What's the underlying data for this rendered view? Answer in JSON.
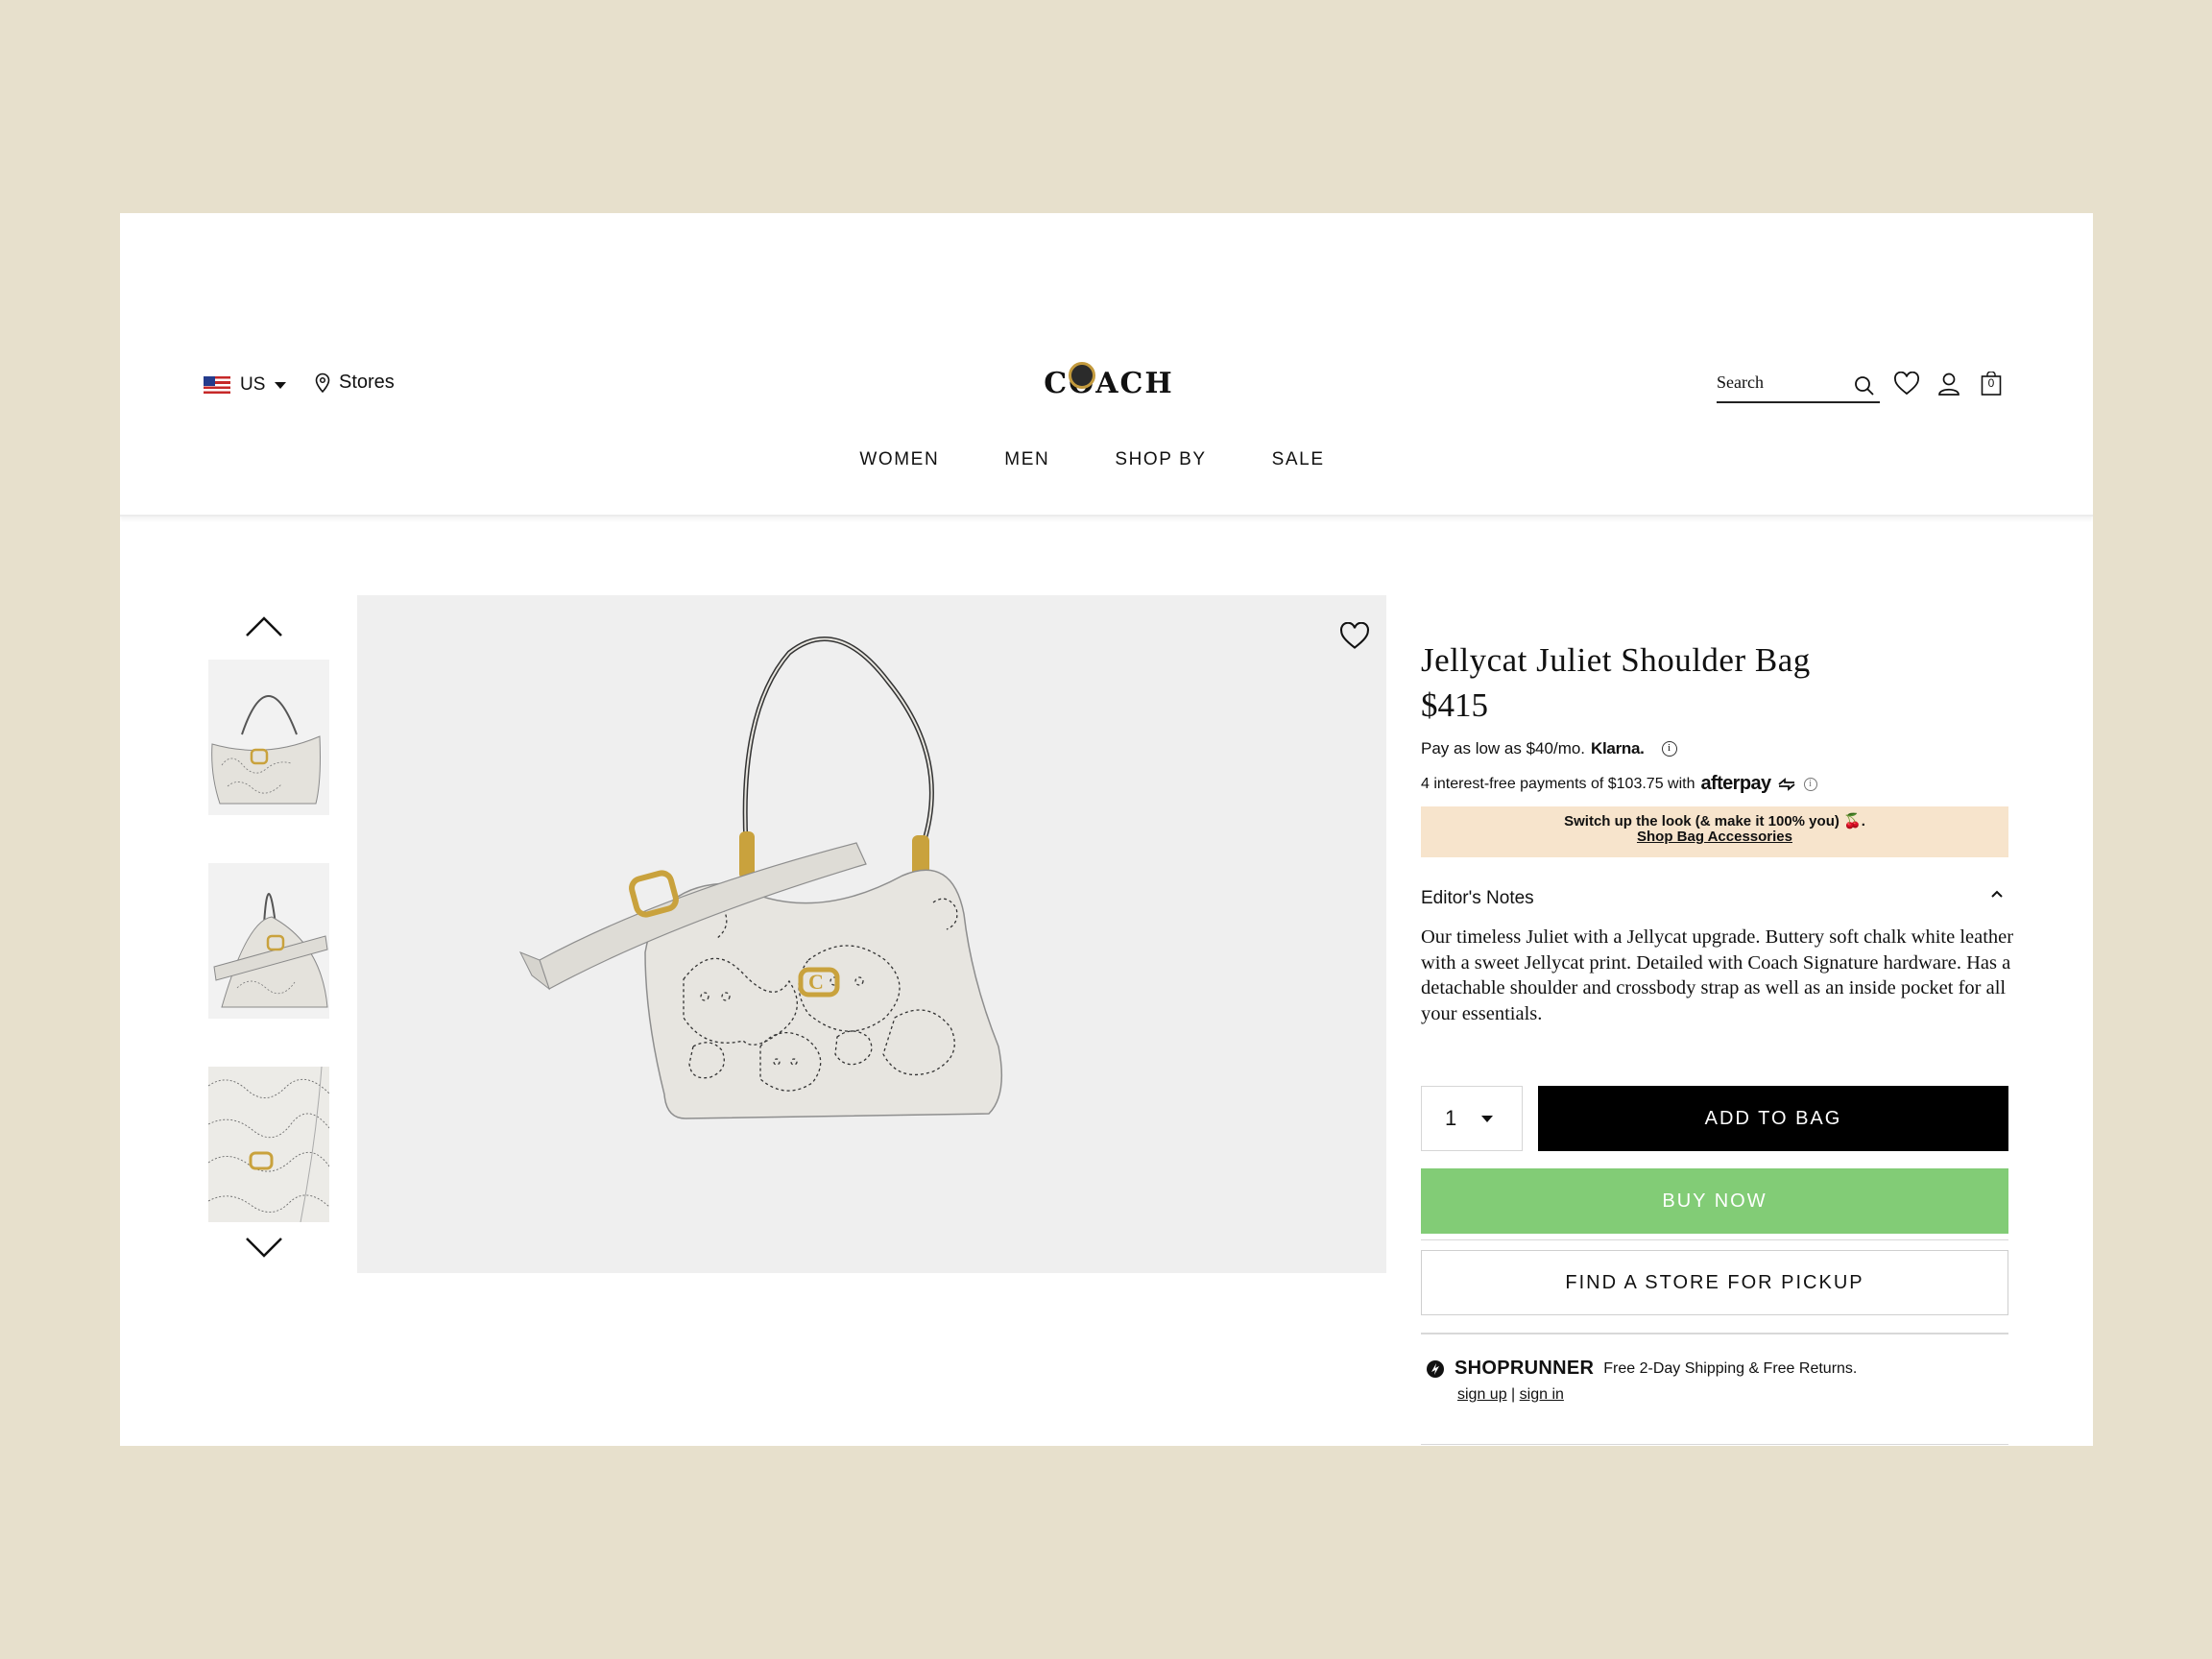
{
  "header": {
    "locale": "US",
    "stores_label": "Stores",
    "brand": "COACH",
    "search_placeholder": "Search",
    "bag_count": "0",
    "nav": [
      "WOMEN",
      "MEN",
      "SHOP BY",
      "SALE"
    ]
  },
  "product": {
    "title": "Jellycat Juliet Shoulder Bag",
    "price": "$415",
    "klarna": {
      "text": "Pay as low as $40/mo.",
      "brand": "Klarna."
    },
    "afterpay": {
      "text": "4 interest-free payments of $103.75 with",
      "brand": "afterpay"
    },
    "promo": {
      "text": "Switch up the look (& make it 100% you) 🍒.",
      "link": "Shop Bag Accessories"
    },
    "editors_notes": {
      "heading": "Editor's Notes",
      "body": "Our timeless Juliet with a Jellycat upgrade. Buttery soft chalk white leather with a sweet Jellycat print. Detailed with Coach Signature hardware. Has a detachable shoulder and crossbody strap as well as an inside pocket for all your essentials."
    },
    "quantity": "1",
    "add_to_bag": "ADD TO BAG",
    "buy_now": "BUY NOW",
    "find_store": "FIND A STORE FOR PICKUP"
  },
  "shoprunner": {
    "brand": "SHOPRUNNER",
    "text": "Free 2-Day Shipping & Free Returns.",
    "sign_up": "sign up",
    "separator": "|",
    "sign_in": "sign in"
  },
  "colors": {
    "background": "#e7e0cc",
    "buy_now": "#82cc76",
    "promo_bg": "#f7e4cc",
    "add_to_bag": "#000000"
  }
}
